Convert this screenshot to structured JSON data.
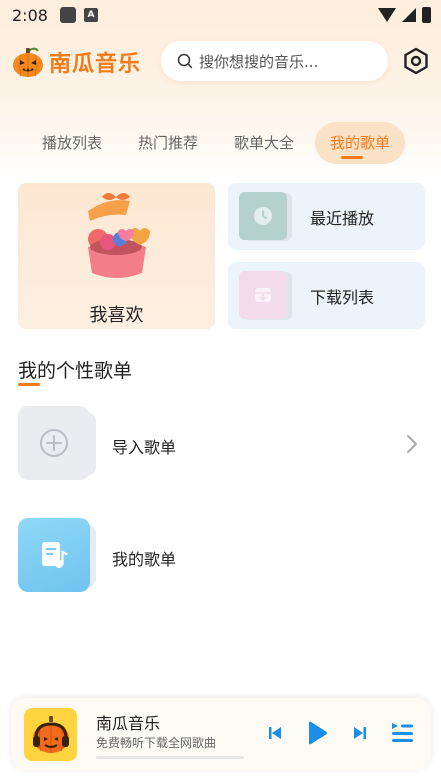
{
  "status_bar": {
    "time": "2:08",
    "badge_letter": "A"
  },
  "header": {
    "app_title": "南瓜音乐",
    "search_placeholder": "搜你想搜的音乐..."
  },
  "tabs": [
    {
      "label": "播放列表",
      "active": false
    },
    {
      "label": "热门推荐",
      "active": false
    },
    {
      "label": "歌单大全",
      "active": false
    },
    {
      "label": "我的歌单",
      "active": true
    }
  ],
  "favorites": {
    "label": "我喜欢"
  },
  "quick_actions": [
    {
      "label": "最近播放",
      "icon": "clock-icon"
    },
    {
      "label": "下载列表",
      "icon": "download-box-icon"
    }
  ],
  "section": {
    "title": "我的个性歌单"
  },
  "playlists": [
    {
      "label": "导入歌单",
      "icon": "plus-circle-icon"
    },
    {
      "label": "我的歌单",
      "icon": "music-note-doc-icon"
    }
  ],
  "player": {
    "title": "南瓜音乐",
    "subtitle": "免费畅听下载全网歌曲",
    "progress": 0.0
  },
  "colors": {
    "accent": "#f07b18",
    "player_blue": "#1a8ee8"
  }
}
